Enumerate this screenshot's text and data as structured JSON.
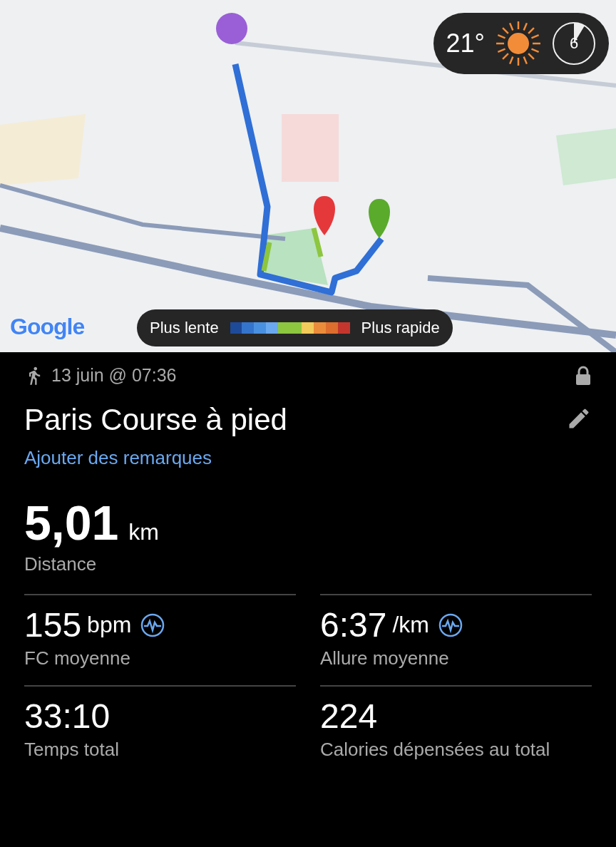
{
  "map": {
    "kind": "picture",
    "attribution": "Google",
    "weather": {
      "temperature": "21°",
      "uv_index": "6"
    },
    "legend": {
      "slow_label": "Plus lente",
      "fast_label": "Plus rapide",
      "segments": [
        {
          "color": "#1e4a9a"
        },
        {
          "color": "#3574cc"
        },
        {
          "color": "#4a90e0"
        },
        {
          "color": "#6aa8f0"
        },
        {
          "color": "#8dc63f"
        },
        {
          "color": "#8dc63f"
        },
        {
          "color": "#f2cb5a"
        },
        {
          "color": "#eb8c3a"
        },
        {
          "color": "#dd6e2e"
        },
        {
          "color": "#c4362d"
        }
      ]
    }
  },
  "activity": {
    "date": "13 juin @ 07:36",
    "locked": true,
    "title": "Paris Course à pied",
    "notes_link": "Ajouter des remarques"
  },
  "main_stat": {
    "value": "5,01",
    "unit": "km",
    "label": "Distance"
  },
  "stats": [
    {
      "value": "155",
      "unit": "bpm",
      "label": "FC moyenne",
      "chart_icon": true
    },
    {
      "value": "6:37",
      "unit": "/km",
      "label": "Allure moyenne",
      "chart_icon": true
    },
    {
      "value": "33:10",
      "label": "Temps total",
      "chart_icon": false
    },
    {
      "value": "224",
      "label": "Calories dépensées au total",
      "chart_icon": false
    }
  ]
}
